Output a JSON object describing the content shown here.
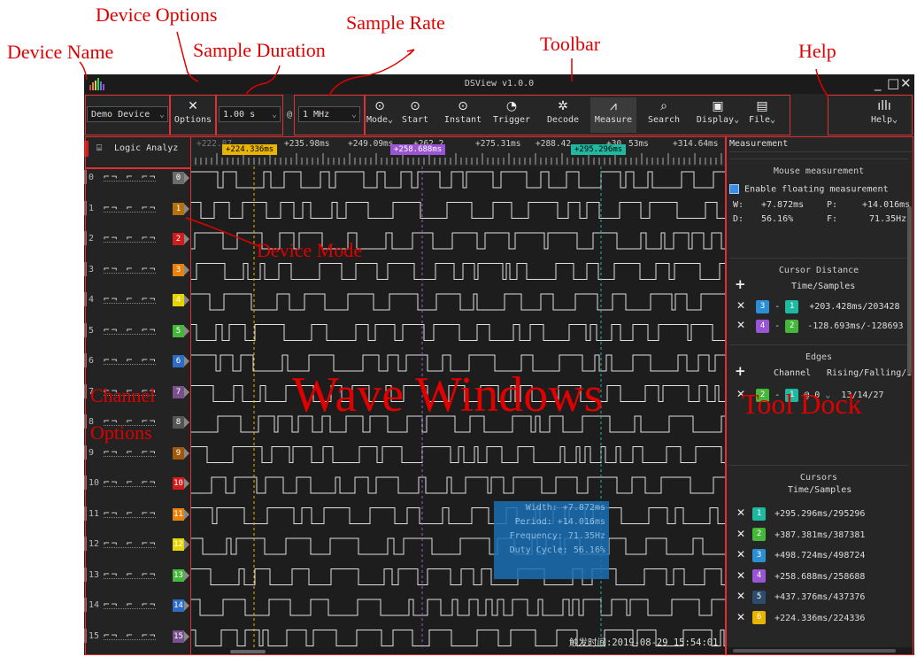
{
  "annotations": {
    "device_name": "Device Name",
    "device_options": "Device Options",
    "sample_duration": "Sample Duration",
    "sample_rate": "Sample Rate",
    "toolbar": "Toolbar",
    "help": "Help",
    "device_mode": "Device Mode",
    "wave_windows": "Wave Windows",
    "channel_options_1": "Channel",
    "channel_options_2": "Options",
    "tool_dock": "Tool Dock"
  },
  "window": {
    "title": "DSView v1.0.0",
    "min": "_",
    "max": "□",
    "close": "✕"
  },
  "toolbar": {
    "device": "Demo Device",
    "options": "Options",
    "duration": "1.00 s",
    "at": "@",
    "rate": "1 MHz",
    "mode": "Mode",
    "start": "Start",
    "instant": "Instant",
    "trigger": "Trigger",
    "decode": "Decode",
    "measure": "Measure",
    "search": "Search",
    "display": "Display",
    "file": "File",
    "help": "Help"
  },
  "mode_tab": "Logic Analyz",
  "ruler": {
    "labels": [
      "+235.98ms",
      "+249.09ms",
      "+275.31ms",
      "+314.64ms"
    ],
    "partial_labels": [
      "+222.87",
      "+262.2",
      "+288.42",
      "+30",
      "53ms"
    ],
    "cursor_tags": [
      {
        "text": "+224.336ms",
        "color": "#e8b400"
      },
      {
        "text": "+258.688ms",
        "color": "#9a55d4"
      },
      {
        "text": "+295.296ms",
        "color": "#1fb8a0"
      }
    ]
  },
  "channels": [
    {
      "id": "0",
      "color": "#6b6b6b"
    },
    {
      "id": "1",
      "color": "#b8700a"
    },
    {
      "id": "2",
      "color": "#d41b1b"
    },
    {
      "id": "3",
      "color": "#e8820a"
    },
    {
      "id": "4",
      "color": "#e8d400"
    },
    {
      "id": "5",
      "color": "#45b83a"
    },
    {
      "id": "6",
      "color": "#2c6cc4"
    },
    {
      "id": "7",
      "color": "#7a4f8e"
    },
    {
      "id": "8",
      "color": "#555555"
    },
    {
      "id": "9",
      "color": "#a0590a"
    },
    {
      "id": "10",
      "color": "#d41b1b"
    },
    {
      "id": "11",
      "color": "#e8820a"
    },
    {
      "id": "12",
      "color": "#e8d400"
    },
    {
      "id": "13",
      "color": "#45b83a"
    },
    {
      "id": "14",
      "color": "#2c6cc4"
    },
    {
      "id": "15",
      "color": "#7a4f8e"
    }
  ],
  "trigger_glyphs": "⌐¬ ⌐ ⌐¬",
  "measure_popup": {
    "width": "Width: +7.872ms",
    "period": "Period: +14.016ms",
    "frequency": "Frequency: 71.35Hz",
    "duty": "Duty Cycle: 56.16%"
  },
  "trigger_time": "触发时间:2019-08-29 15:54:01",
  "dock": {
    "header": "Measurement",
    "mouse": {
      "title": "Mouse measurement",
      "enable": "Enable floating measurement",
      "w_label": "W:",
      "w_val": "+7.872ms",
      "p_label": "P:",
      "p_val": "+14.016ms",
      "d_label": "D:",
      "d_val": "56.16%",
      "f_label": "F:",
      "f_val": "71.35Hz"
    },
    "distance": {
      "title": "Cursor Distance",
      "col": "Time/Samples",
      "rows": [
        {
          "a": "3",
          "a_color": "#2c6cc4",
          "b": "1",
          "b_color": "#1fb8a0",
          "val": "+203.428ms/203428"
        },
        {
          "a": "4",
          "a_color": "#9a55d4",
          "b": "2",
          "b_color": "#45b83a",
          "val": "-128.693ms/-128693"
        }
      ]
    },
    "edges": {
      "title": "Edges",
      "col1": "Channel",
      "col2": "Rising/Falling/I",
      "row": {
        "a": "2",
        "b": "1",
        "at": "@ 0",
        "val": "13/14/27"
      }
    },
    "cursors": {
      "title": "Cursors",
      "col": "Time/Samples",
      "rows": [
        {
          "n": "1",
          "color": "#1fb8a0",
          "val": "+295.296ms/295296"
        },
        {
          "n": "2",
          "color": "#45b83a",
          "val": "+387.381ms/387381"
        },
        {
          "n": "3",
          "color": "#2c8ed4",
          "val": "+498.724ms/498724"
        },
        {
          "n": "4",
          "color": "#9a55d4",
          "val": "+258.688ms/258688"
        },
        {
          "n": "5",
          "color": "#2c4d6e",
          "val": "+437.376ms/437376"
        },
        {
          "n": "6",
          "color": "#e8b400",
          "val": "+224.336ms/224336"
        }
      ]
    }
  }
}
